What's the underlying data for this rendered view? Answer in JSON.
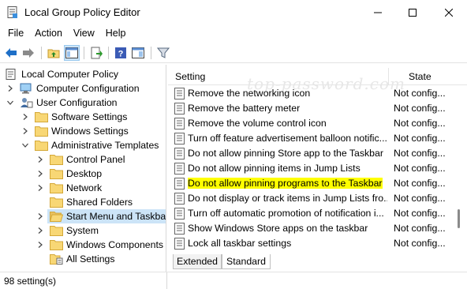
{
  "window": {
    "title": "Local Group Policy Editor",
    "controls": [
      "minimize-icon",
      "maximize-icon",
      "close-icon"
    ]
  },
  "menu": [
    "File",
    "Action",
    "View",
    "Help"
  ],
  "toolbar": [
    "back-arrow-icon",
    "forward-arrow-icon",
    "up-folder-icon",
    "show-hide-tree-icon",
    "export-list-icon",
    "help-icon",
    "console-view-icon",
    "filter-icon"
  ],
  "tree": {
    "root": "Local Computer Policy",
    "computer_config": "Computer Configuration",
    "user_config": "User Configuration",
    "software_settings": "Software Settings",
    "windows_settings": "Windows Settings",
    "admin_templates": "Administrative Templates",
    "control_panel": "Control Panel",
    "desktop": "Desktop",
    "network": "Network",
    "shared_folders": "Shared Folders",
    "start_menu": "Start Menu and Taskbar",
    "system": "System",
    "windows_components": "Windows Components",
    "all_settings": "All Settings"
  },
  "list": {
    "header_setting": "Setting",
    "header_state": "State",
    "watermark": "top-password.com",
    "rows": [
      {
        "name": "Remove the networking icon",
        "state": "Not config..."
      },
      {
        "name": "Remove the battery meter",
        "state": "Not config..."
      },
      {
        "name": "Remove the volume control icon",
        "state": "Not config..."
      },
      {
        "name": "Turn off feature advertisement balloon notific...",
        "state": "Not config..."
      },
      {
        "name": "Do not allow pinning Store app to the Taskbar",
        "state": "Not config..."
      },
      {
        "name": "Do not allow pinning items in Jump Lists",
        "state": "Not config..."
      },
      {
        "name": "Do not allow pinning programs to the Taskbar",
        "state": "Not config..."
      },
      {
        "name": "Do not display or track items in Jump Lists fro...",
        "state": "Not config..."
      },
      {
        "name": "Turn off automatic promotion of notification i...",
        "state": "Not config..."
      },
      {
        "name": "Show Windows Store apps on the taskbar",
        "state": "Not config..."
      },
      {
        "name": "Lock all taskbar settings",
        "state": "Not config..."
      }
    ]
  },
  "tabs": {
    "extended": "Extended",
    "standard": "Standard"
  },
  "status": {
    "text": "98 setting(s)"
  },
  "colors": {
    "selection": "#cce4f7",
    "highlight": "#ffff00",
    "folder": "#f8d775",
    "toolbar_blue": "#1e6fc7"
  }
}
